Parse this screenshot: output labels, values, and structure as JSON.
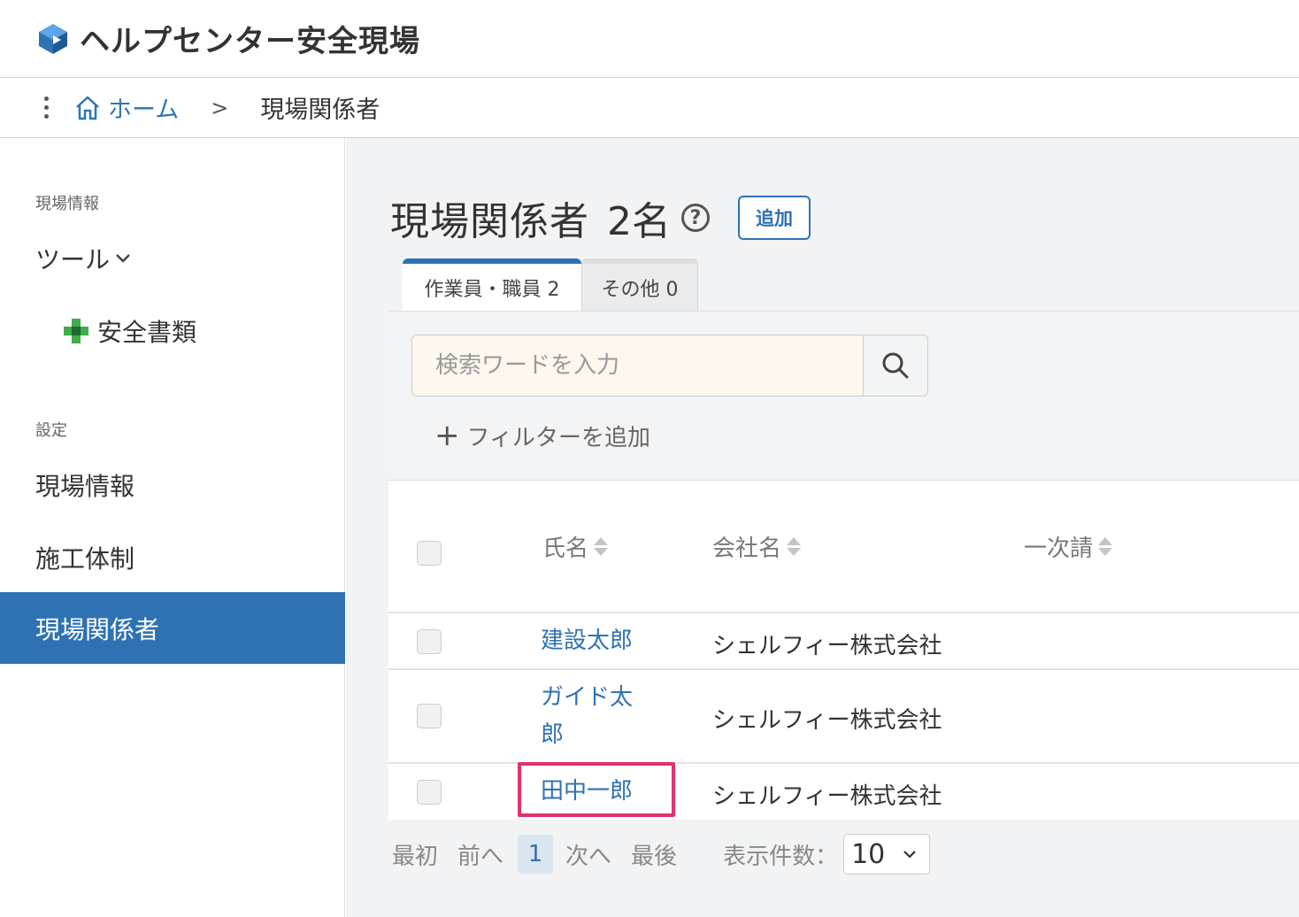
{
  "header": {
    "title": "ヘルプセンター安全現場",
    "logo_icon": "cube-logo-icon"
  },
  "breadcrumb": {
    "home_label": "ホーム",
    "separator": ">",
    "current": "現場関係者"
  },
  "sidebar": {
    "section_site": "現場情報",
    "tools_label": "ツール",
    "tools_items": [
      {
        "label": "安全書類",
        "icon": "green-cross-icon"
      }
    ],
    "section_settings": "設定",
    "settings_items": [
      {
        "label": "現場情報",
        "active": false
      },
      {
        "label": "施工体制",
        "active": false
      },
      {
        "label": "現場関係者",
        "active": true
      }
    ]
  },
  "main": {
    "title": "現場関係者",
    "count": "2名",
    "help": "?",
    "add_label": "追加",
    "tabs": [
      {
        "label": "作業員・職員 2",
        "active": true
      },
      {
        "label": "その他 0",
        "active": false
      }
    ],
    "search": {
      "placeholder": "検索ワードを入力",
      "value": ""
    },
    "filter_add": "フィルターを追加",
    "columns": [
      "氏名",
      "会社名",
      "一次請"
    ],
    "rows": [
      {
        "name": "建設太郎",
        "company": "シェルフィー株式会社",
        "first_tier": ""
      },
      {
        "name": "ガイド太郎",
        "company": "シェルフィー株式会社",
        "first_tier": ""
      },
      {
        "name": "田中一郎",
        "company": "シェルフィー株式会社",
        "first_tier": ""
      }
    ],
    "highlight_color": "#e2336b",
    "accent_color": "#2e72b4"
  },
  "pagination": {
    "first": "最初",
    "prev": "前へ",
    "current_page": "1",
    "next": "次へ",
    "last": "最後",
    "per_page_label": "表示件数：",
    "per_page_value": "10"
  }
}
